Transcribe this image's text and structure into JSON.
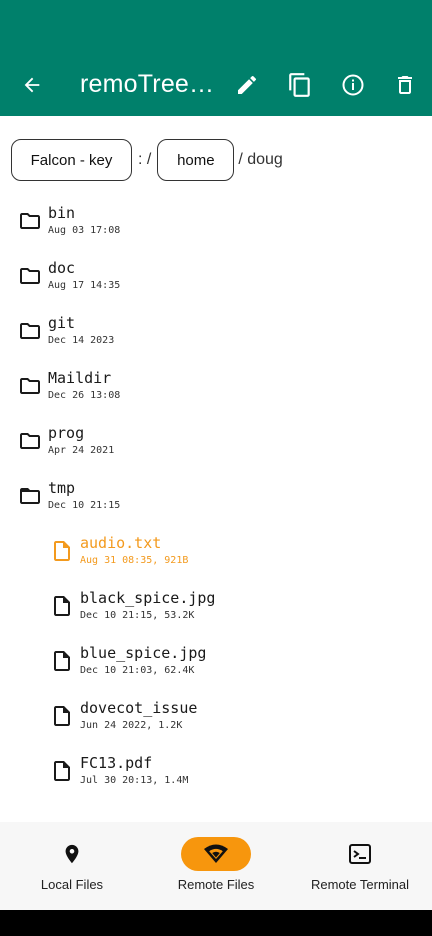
{
  "appbar": {
    "title": "remoTree…",
    "actions": [
      "edit-icon",
      "copy-icon",
      "info-icon",
      "delete-icon"
    ]
  },
  "breadcrumb": {
    "host": "Falcon - key",
    "separator1": ": /",
    "segment": "home",
    "tail": "/ doug"
  },
  "files": [
    {
      "name": "bin",
      "meta": "Aug 03 17:08",
      "type": "folder"
    },
    {
      "name": "doc",
      "meta": "Aug 17 14:35",
      "type": "folder"
    },
    {
      "name": "git",
      "meta": "Dec 14  2023",
      "type": "folder"
    },
    {
      "name": "Maildir",
      "meta": "Dec 26 13:08",
      "type": "folder"
    },
    {
      "name": "prog",
      "meta": "Apr 24  2021",
      "type": "folder"
    },
    {
      "name": "tmp",
      "meta": "Dec 10 21:15",
      "type": "folder-open"
    },
    {
      "name": "audio.txt",
      "meta": "Aug 31 08:35, 921B",
      "type": "file",
      "selected": true
    },
    {
      "name": "black_spice.jpg",
      "meta": "Dec 10 21:15, 53.2K",
      "type": "file"
    },
    {
      "name": "blue_spice.jpg",
      "meta": "Dec 10 21:03, 62.4K",
      "type": "file"
    },
    {
      "name": "dovecot_issue",
      "meta": "Jun 24  2022, 1.2K",
      "type": "file"
    },
    {
      "name": "FC13.pdf",
      "meta": "Jul 30 20:13, 1.4M",
      "type": "file"
    }
  ],
  "nav": {
    "items": [
      {
        "label": "Local Files",
        "icon": "location-pin-icon"
      },
      {
        "label": "Remote Files",
        "icon": "wifi-icon",
        "active": true
      },
      {
        "label": "Remote Terminal",
        "icon": "terminal-icon"
      }
    ]
  },
  "colors": {
    "appbar": "#00806B",
    "accent": "#F7960D",
    "selected_text": "#F39A1E"
  }
}
